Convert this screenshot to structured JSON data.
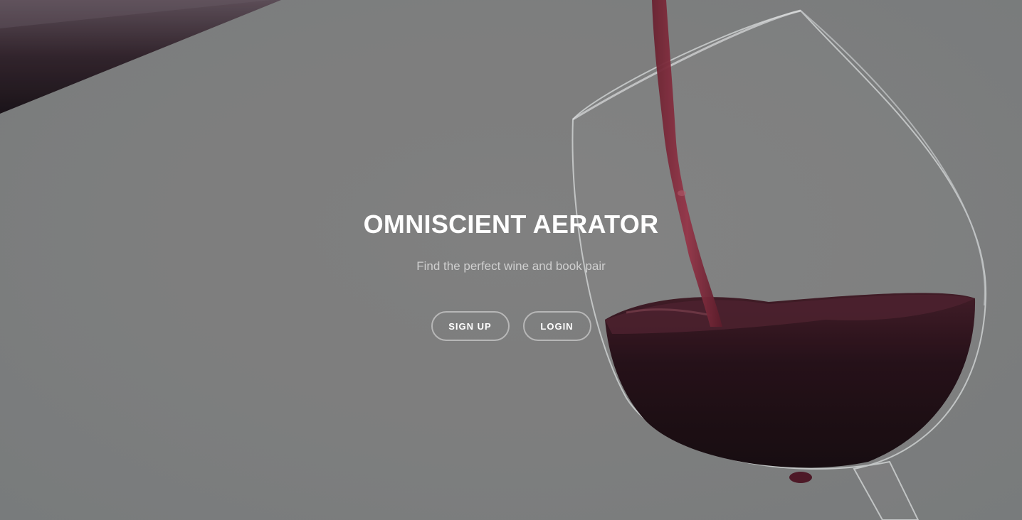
{
  "hero": {
    "title": "OMNISCIENT AERATOR",
    "subtitle": "Find the perfect wine and book pair",
    "background_image": "wine-pouring-into-glass",
    "buttons": {
      "signup_label": "SIGN UP",
      "login_label": "LOGIN"
    }
  },
  "colors": {
    "background": "#808080",
    "title": "#ffffff",
    "subtitle": "#cfcfcf",
    "button_border": "#d9d9d9",
    "wine": "#2a0a12"
  }
}
